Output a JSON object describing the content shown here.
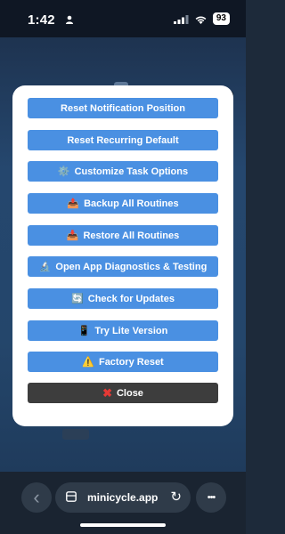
{
  "status_bar": {
    "time": "1:42",
    "battery": "93"
  },
  "modal": {
    "buttons": [
      {
        "label": "Reset Notification Position",
        "icon": ""
      },
      {
        "label": "Reset Recurring Default",
        "icon": ""
      },
      {
        "label": "Customize Task Options",
        "icon": "⚙️",
        "icon_name": "gear-icon"
      },
      {
        "label": "Backup All Routines",
        "icon": "📤",
        "icon_name": "tray-upload-icon"
      },
      {
        "label": "Restore All Routines",
        "icon": "📥",
        "icon_name": "tray-download-icon"
      },
      {
        "label": "Open App Diagnostics & Testing",
        "icon": "🔬",
        "icon_name": "microscope-icon"
      },
      {
        "label": "Check for Updates",
        "icon": "🔄",
        "icon_name": "refresh-icon"
      },
      {
        "label": "Try Lite Version",
        "icon": "📱",
        "icon_name": "phone-icon"
      },
      {
        "label": "Factory Reset",
        "icon": "⚠️",
        "icon_name": "warning-icon"
      }
    ],
    "close": {
      "label": "Close",
      "icon": "✖",
      "icon_name": "close-x-icon"
    }
  },
  "browser": {
    "url": "minicycle.app",
    "back_icon": "‹",
    "reload_icon": "↻",
    "more_icon": "•••"
  },
  "colors": {
    "button_blue": "#4a90e2",
    "close_button": "#3d3d3d",
    "close_x": "#e53935"
  }
}
